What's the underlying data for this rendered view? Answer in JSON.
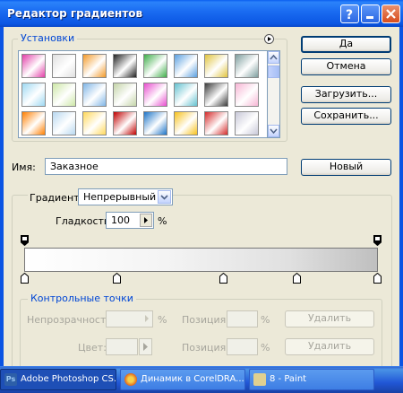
{
  "window": {
    "title": "Редактор градиентов"
  },
  "presets": {
    "label": "Установки",
    "swatches": [
      [
        "#E33FA8",
        "#E0E0E0",
        "#F39A2A",
        "#222222",
        "#3FAE4A",
        "#5BA0E0",
        "#E0C43F",
        "#7E9E9E"
      ],
      [
        "#9DD8F2",
        "#CDE7A6",
        "#7FB5E6",
        "#C4D4A8",
        "#E84ECF",
        "#63C1D0",
        "#3B3B3B",
        "#F7B5D4"
      ],
      [
        "#FF7F00",
        "#B8D8F0",
        "#FFD85A",
        "#C00000",
        "#1D74C8",
        "#F7C21E",
        "#D52B2B",
        "#C8C8D8"
      ],
      [
        "#E8A088",
        "#FFC8B4",
        "#3A7AC8",
        "#203090",
        "#C8C8C8",
        "#F0F0F0",
        "#9090A0",
        "#7C7CD8"
      ]
    ]
  },
  "buttons": {
    "ok": "Да",
    "cancel": "Отмена",
    "load": "Загрузить...",
    "save": "Сохранить...",
    "new": "Новый",
    "delete1": "Удалить",
    "delete2": "Удалить"
  },
  "name_row": {
    "label": "Имя:",
    "value": "Заказное"
  },
  "gradient": {
    "type_label": "Градиент:",
    "type_value": "Непрерывный",
    "smooth_label": "Гладкость:",
    "smooth_value": "100",
    "smooth_unit": "%"
  },
  "control_points": {
    "label": "Контрольные точки",
    "opacity_label": "Непрозрачность:",
    "opacity_unit": "%",
    "position_label_1": "Позиция:",
    "position_unit_1": "%",
    "color_label": "Цвет:",
    "position_label_2": "Позиция:",
    "position_unit_2": "%"
  },
  "taskbar": {
    "items": [
      {
        "label": "Adobe Photoshop CS...",
        "icon_color": "#2D5FA8"
      },
      {
        "label": "Динамик в CorelDRA...",
        "icon_color": "#E8A21C"
      },
      {
        "label": "8 - Paint",
        "icon_color": "#E0D090"
      }
    ]
  }
}
